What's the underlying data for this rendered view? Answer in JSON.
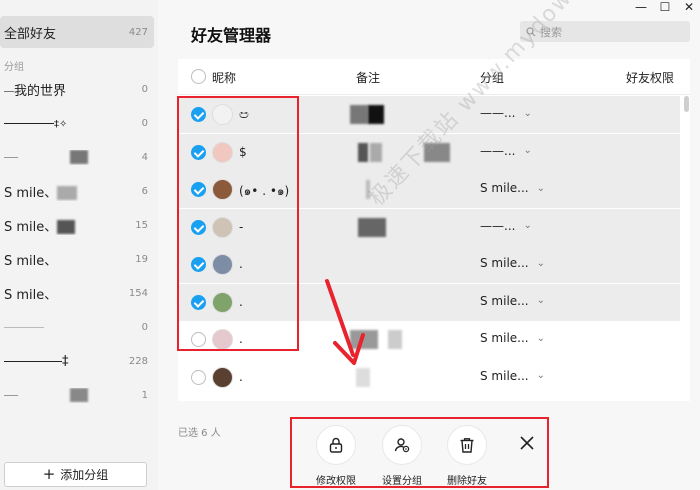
{
  "sidebar": {
    "all_friends": {
      "label": "全部好友",
      "count": "427"
    },
    "section_label": "分组",
    "groups": [
      {
        "label": "我的世界",
        "count": "0"
      },
      {
        "label": "‡✧",
        "count": "0"
      },
      {
        "label": "",
        "count": "4"
      },
      {
        "label": "S mile、",
        "count": "6"
      },
      {
        "label": "S mile、",
        "count": "15"
      },
      {
        "label": "S mile、",
        "count": "19"
      },
      {
        "label": "S mile、",
        "count": "154"
      },
      {
        "label": "",
        "count": "0"
      },
      {
        "label": "‡",
        "count": "228"
      },
      {
        "label": "",
        "count": "1"
      }
    ],
    "add_group_label": "添加分组"
  },
  "header": {
    "title": "好友管理器",
    "search_placeholder": "搜索",
    "window_controls": [
      "—",
      "☐",
      "✕"
    ]
  },
  "table": {
    "columns": [
      "昵称",
      "备注",
      "分组",
      "好友权限"
    ],
    "rows": [
      {
        "selected": true,
        "nickname": "ඏ",
        "group": "——...",
        "avatar_color": "#f2f2f2"
      },
      {
        "selected": true,
        "nickname": "$",
        "group": "——...",
        "avatar_color": "#f0c8c0"
      },
      {
        "selected": true,
        "nickname": "(๑• . •๑)",
        "group": "S mile...",
        "avatar_color": "#8a5a3a"
      },
      {
        "selected": true,
        "nickname": "-",
        "group": "——...",
        "avatar_color": "#cfc3b5"
      },
      {
        "selected": true,
        "nickname": ".",
        "group": "S mile...",
        "avatar_color": "#7d8da5"
      },
      {
        "selected": true,
        "nickname": ".",
        "group": "S mile...",
        "avatar_color": "#7fa36b"
      },
      {
        "selected": false,
        "nickname": ".",
        "group": "S mile...",
        "avatar_color": "#e6c9cf"
      },
      {
        "selected": false,
        "nickname": ".",
        "group": "S mile...",
        "avatar_color": "#5a4030"
      }
    ]
  },
  "footer": {
    "selected_text": "已选 6 人",
    "actions": {
      "edit_permission": "修改权限",
      "set_group": "设置分组",
      "delete_friend": "删除好友"
    }
  },
  "overlay": {
    "watermark": "极速下载站 www.mydown.com",
    "annotation_color": "#e8232d",
    "accent": "#1aa0f0"
  }
}
